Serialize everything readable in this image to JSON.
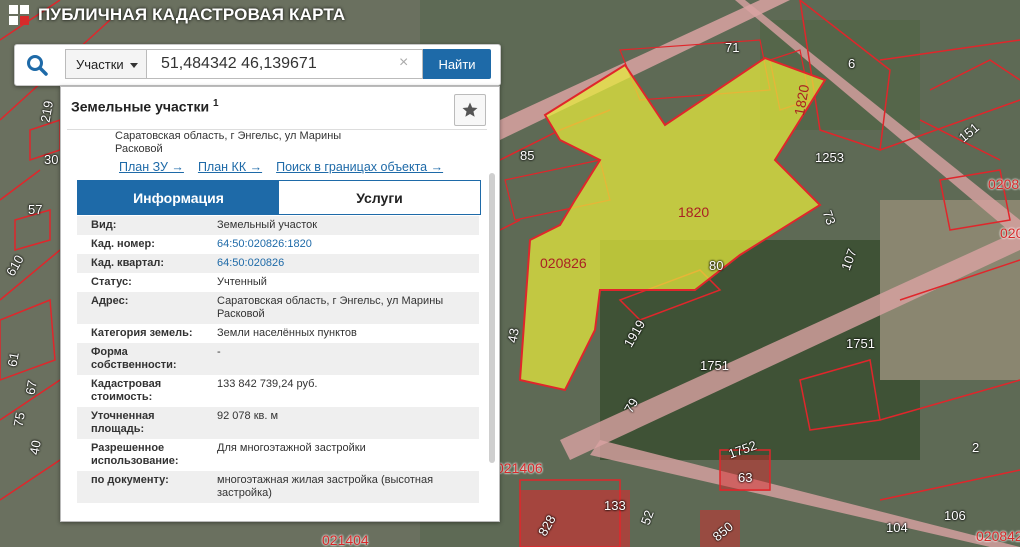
{
  "header": {
    "title": "ПУБЛИЧНАЯ КАДАСТРОВАЯ КАРТА",
    "logo_icon": "cadastral-logo-icon"
  },
  "search": {
    "type_label": "Участки",
    "query": "51,484342 46,139671",
    "clear_glyph": "×",
    "button_label": "Найти"
  },
  "panel": {
    "title": "Земельные участки",
    "title_sup": "1",
    "address_header": "Саратовская область, г Энгельс, ул Марины Расковой",
    "links": [
      "План ЗУ →",
      "План КК →",
      "Поиск в границах объекта →"
    ],
    "tabs": [
      "Информация",
      "Услуги"
    ],
    "rows": [
      {
        "key": "Вид:",
        "value": "Земельный участок",
        "link": false
      },
      {
        "key": "Кад. номер:",
        "value": "64:50:020826:1820",
        "link": true
      },
      {
        "key": "Кад. квартал:",
        "value": "64:50:020826",
        "link": true
      },
      {
        "key": "Статус:",
        "value": "Учтенный",
        "link": false
      },
      {
        "key": "Адрес:",
        "value": "Саратовская область, г Энгельс, ул Марины Расковой",
        "link": false
      },
      {
        "key": "Категория земель:",
        "value": "Земли населённых пунктов",
        "link": false
      },
      {
        "key": "Форма собственности:",
        "value": "-",
        "link": false
      },
      {
        "key": "Кадастровая стоимость:",
        "value": "133 842 739,24 руб.",
        "link": false
      },
      {
        "key": "Уточненная площадь:",
        "value": "92 078 кв. м",
        "link": false
      },
      {
        "key": "Разрешенное использование:",
        "value": "Для многоэтажной застройки",
        "link": false
      },
      {
        "key": "по документу:",
        "value": "многоэтажная жилая застройка (высотная застройка)",
        "link": false
      }
    ]
  },
  "map": {
    "labels": [
      "71",
      "6",
      "1820",
      "85",
      "1253",
      "151",
      "020826",
      "1820",
      "73",
      "020826",
      "107",
      "80",
      "1919",
      "1751",
      "1751",
      "43",
      "79",
      "1752",
      "63",
      "021406",
      "133",
      "52",
      "828",
      "850",
      "104",
      "106",
      "020842",
      "021404",
      "610",
      "57",
      "67",
      "61",
      "75",
      "40",
      "30",
      "219",
      "2",
      "020"
    ],
    "colors": {
      "parcel": "#e0262b",
      "selection": "#e9ed3c",
      "road": "#f2b4b4"
    }
  }
}
